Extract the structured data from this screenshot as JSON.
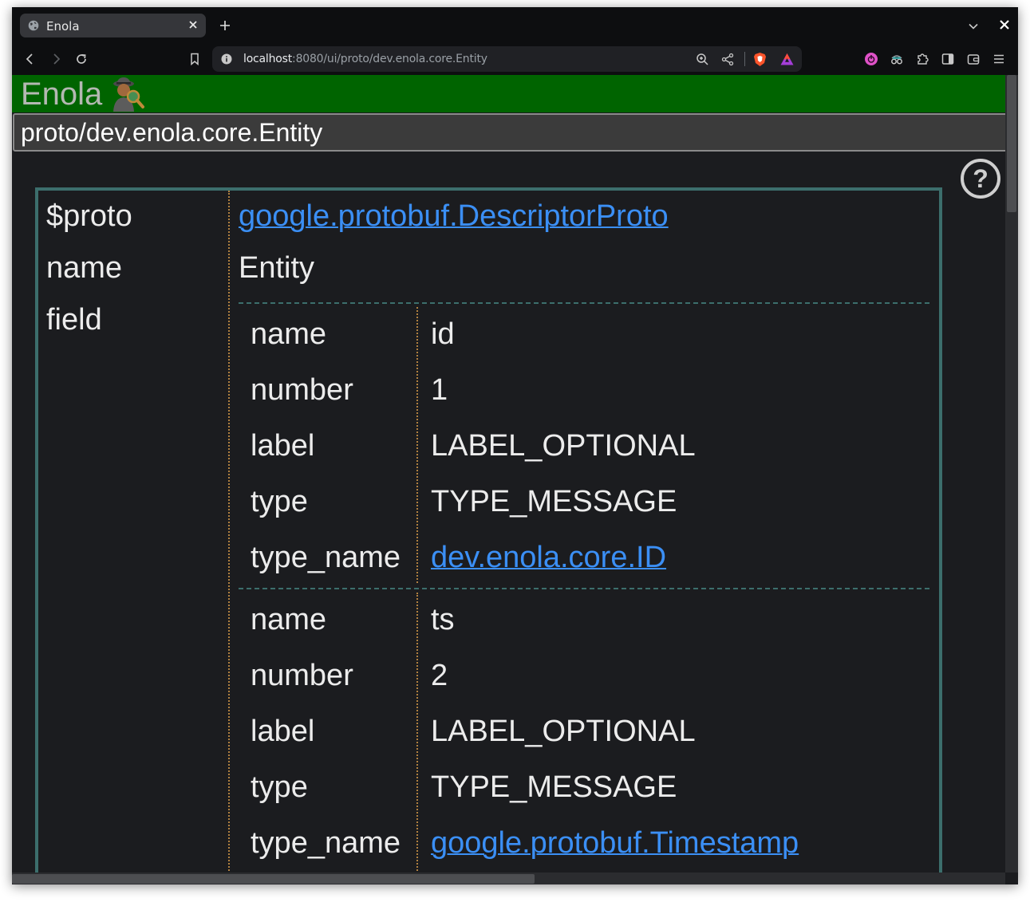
{
  "browser": {
    "tab": {
      "title": "Enola"
    },
    "address": {
      "host": "localhost",
      "rest": ":8080/ui/proto/dev.enola.core.Entity"
    },
    "icons": [
      "globe-icon",
      "close-icon",
      "plus-icon",
      "chevron-down-icon",
      "back-icon",
      "forward-icon",
      "reload-icon",
      "bookmark-icon",
      "info-icon",
      "zoom-icon",
      "share-icon",
      "brave-shield-icon",
      "brave-rewards-icon",
      "vpn-icon",
      "private-icon",
      "extensions-icon",
      "sidebar-icon",
      "wallet-icon",
      "menu-icon"
    ]
  },
  "app": {
    "title": "Enola",
    "header_color": "#006400",
    "search_value": "proto/dev.enola.core.Entity",
    "help_glyph": "?"
  },
  "record": {
    "proto_label": "$proto",
    "proto_value": "google.protobuf.DescriptorProto",
    "name_label": "name",
    "name_value": "Entity",
    "field_label": "field",
    "fields": [
      {
        "name_label": "name",
        "name": "id",
        "number_label": "number",
        "number": "1",
        "label_label": "label",
        "label": "LABEL_OPTIONAL",
        "type_label": "type",
        "type": "TYPE_MESSAGE",
        "type_name_label": "type_name",
        "type_name": "dev.enola.core.ID"
      },
      {
        "name_label": "name",
        "name": "ts",
        "number_label": "number",
        "number": "2",
        "label_label": "label",
        "label": "LABEL_OPTIONAL",
        "type_label": "type",
        "type": "TYPE_MESSAGE",
        "type_name_label": "type_name",
        "type_name": "google.protobuf.Timestamp"
      }
    ]
  },
  "colors": {
    "link": "#3b8ff5",
    "border": "#3c6e6c",
    "divider": "#b08040"
  }
}
